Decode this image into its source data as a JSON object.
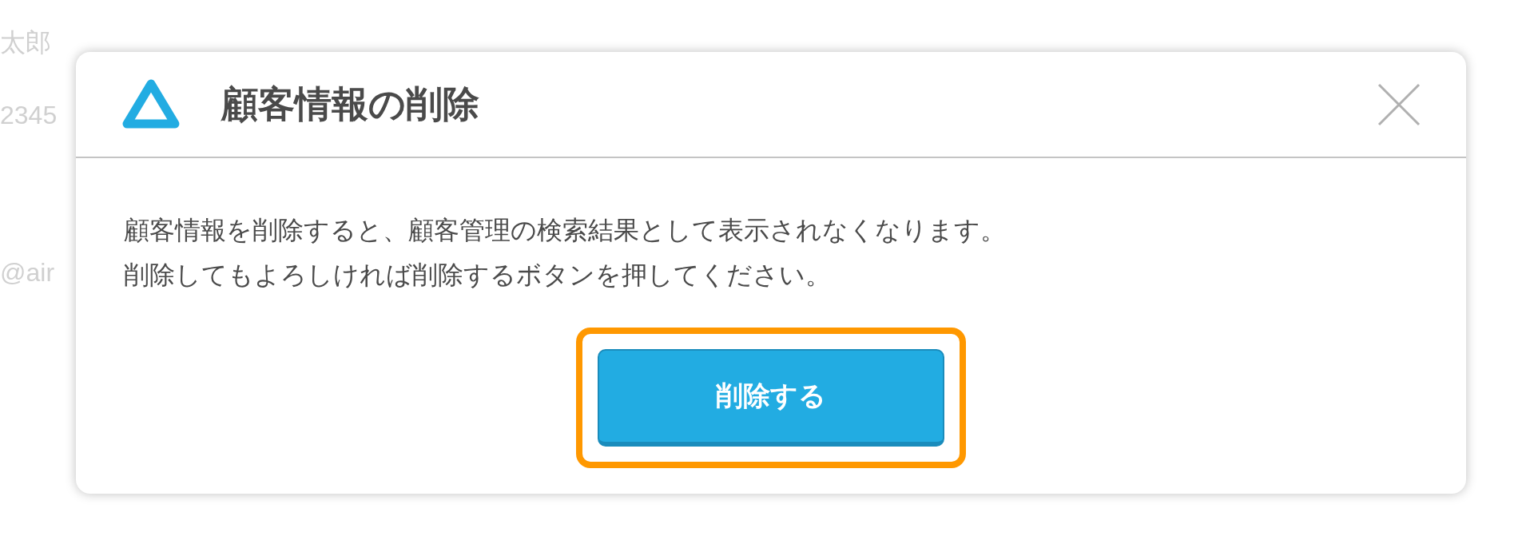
{
  "background_texts": [
    "太郎",
    "2345",
    "@air"
  ],
  "dialog": {
    "title": "顧客情報の削除",
    "message_lines": [
      "顧客情報を削除すると、顧客管理の検索結果として表示されなくなります。",
      "削除してもよろしければ削除するボタンを押してください。"
    ],
    "button": {
      "label": "削除する",
      "highlighted": true
    }
  }
}
